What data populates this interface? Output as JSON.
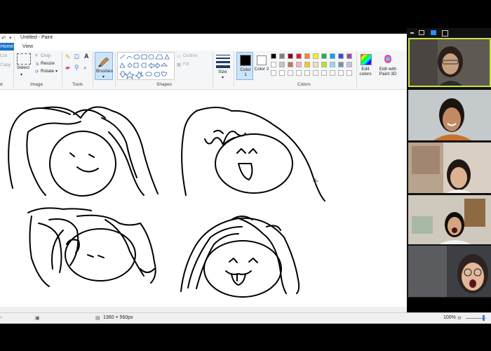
{
  "window": {
    "title": "Untitled - Paint"
  },
  "tabs": {
    "home": "Home",
    "view": "View"
  },
  "clipboard": {
    "cut": "Cut",
    "copy": "Copy"
  },
  "image": {
    "select": "Select",
    "crop": "Crop",
    "resize": "Resize",
    "rotate": "Rotate",
    "label": "Image"
  },
  "tools": {
    "label": "Tools",
    "text_tool": "A"
  },
  "brushes": {
    "label": "Brushes"
  },
  "shapes": {
    "label": "Shapes",
    "outline": "Outline",
    "fill": "Fill"
  },
  "size": {
    "label": "Size"
  },
  "colors": {
    "color1": "Color 1",
    "color2": "Color 2",
    "label": "Colors",
    "edit": "Edit colors",
    "paint3d": "Edit with Paint 3D",
    "palette_row1": [
      "#000000",
      "#7f7f7f",
      "#880015",
      "#ed1c24",
      "#ff7f27",
      "#fff200",
      "#22b14c",
      "#00a2e8",
      "#3f48cc",
      "#a349a4"
    ],
    "palette_row2": [
      "#ffffff",
      "#c3c3c3",
      "#b97a57",
      "#ffaec9",
      "#ffc90e",
      "#efe4b0",
      "#b5e61d",
      "#99d9ea",
      "#7092be",
      "#c8bfe7"
    ]
  },
  "status": {
    "dimensions": "1360 × 560px",
    "zoom": "100%"
  }
}
